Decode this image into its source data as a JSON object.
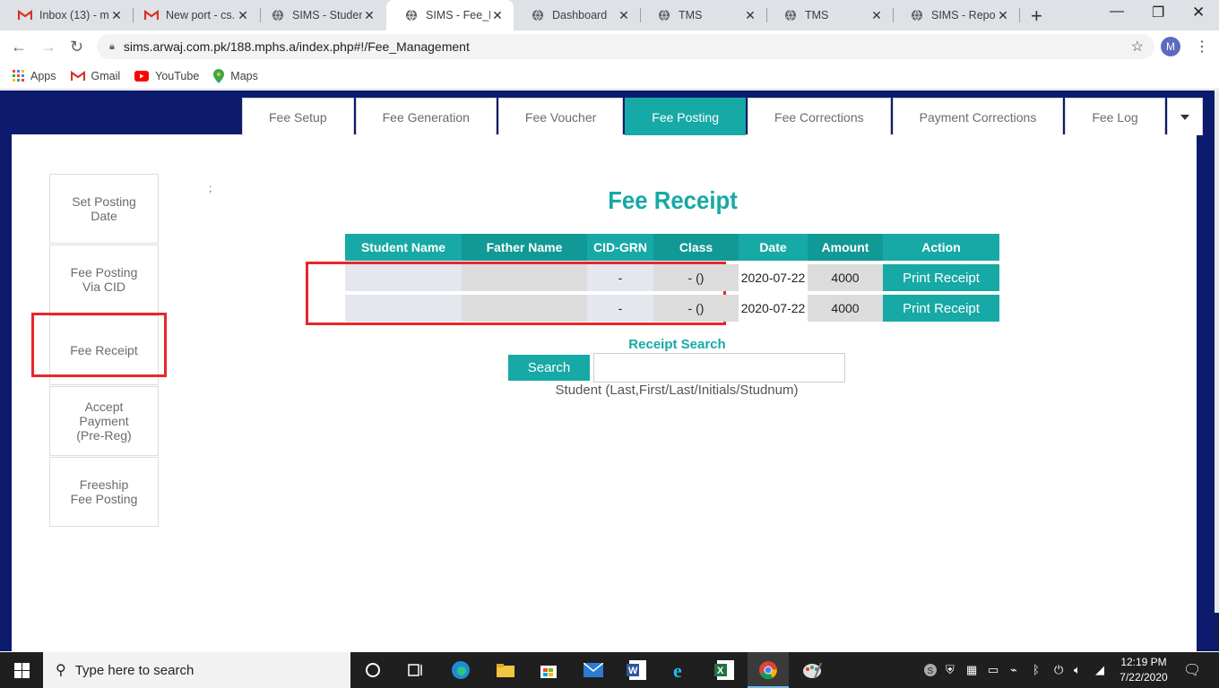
{
  "browser": {
    "tabs": [
      {
        "title": "Inbox (13) - m",
        "icon": "gmail-icon"
      },
      {
        "title": "New port - cs.",
        "icon": "gmail-icon"
      },
      {
        "title": "SIMS - Student",
        "icon": "globe-icon"
      },
      {
        "title": "SIMS - Fee_Ma",
        "icon": "globe-icon",
        "active": true
      },
      {
        "title": "Dashboard",
        "icon": "globe-icon"
      },
      {
        "title": "TMS",
        "icon": "globe-icon"
      },
      {
        "title": "TMS",
        "icon": "globe-icon"
      },
      {
        "title": "SIMS - Report",
        "icon": "globe-icon"
      }
    ],
    "url": "sims.arwaj.com.pk/188.mphs.a/index.php#!/Fee_Management",
    "profile_initial": "M",
    "bookmarks": [
      {
        "label": "Apps",
        "icon": "apps-grid-icon"
      },
      {
        "label": "Gmail",
        "icon": "gmail-icon"
      },
      {
        "label": "YouTube",
        "icon": "youtube-icon"
      },
      {
        "label": "Maps",
        "icon": "maps-pin-icon"
      }
    ]
  },
  "app": {
    "tabs": [
      "Fee Setup",
      "Fee Generation",
      "Fee Voucher",
      "Fee Posting",
      "Fee Corrections",
      "Payment Corrections",
      "Fee Log"
    ],
    "active_tab": "Fee Posting",
    "sidebar": [
      {
        "line1": "Set Posting",
        "line2": "Date"
      },
      {
        "line1": "Fee Posting",
        "line2": "Via CID"
      },
      {
        "line1": "Fee Receipt",
        "line2": ""
      },
      {
        "line1": "Accept",
        "line2": "Payment",
        "line3": "(Pre-Reg)"
      },
      {
        "line1": "Freeship",
        "line2": "Fee Posting"
      }
    ],
    "stray_text": ";",
    "title": "Fee Receipt",
    "table": {
      "headers": [
        "Student Name",
        "Father Name",
        "CID-GRN",
        "Class",
        "Date",
        "Amount",
        "Action"
      ],
      "rows": [
        {
          "student_name": "",
          "father_name": "",
          "cid_grn": "-",
          "class": "- ()",
          "date": "2020-07-22",
          "amount": "4000",
          "action": "Print Receipt"
        },
        {
          "student_name": "",
          "father_name": "",
          "cid_grn": "-",
          "class": "- ()",
          "date": "2020-07-22",
          "amount": "4000",
          "action": "Print Receipt"
        }
      ]
    },
    "receipt_search": {
      "label": "Receipt Search",
      "button": "Search",
      "input_value": "",
      "hint": "Student (Last,First/Last/Initials/Studnum)"
    },
    "accent_color": "#17a9a5",
    "highlight_color": "#e8262a"
  },
  "taskbar": {
    "search_placeholder": "Type here to search",
    "time": "12:19 PM",
    "date": "7/22/2020"
  }
}
